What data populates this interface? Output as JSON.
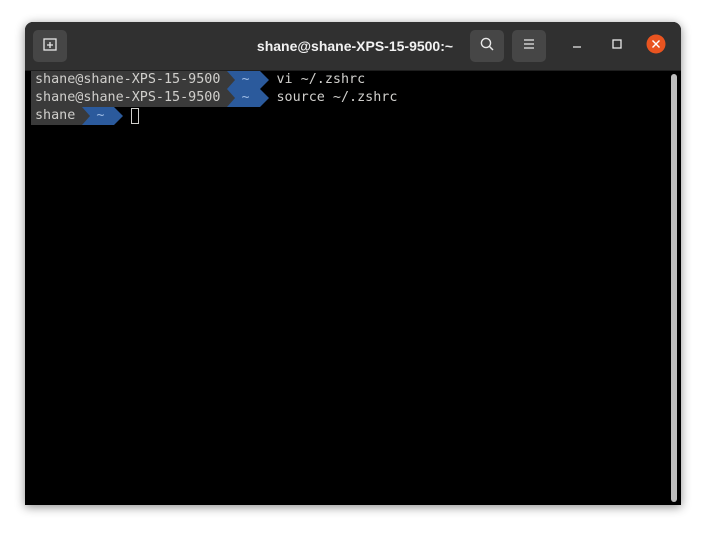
{
  "window": {
    "title": "shane@shane-XPS-15-9500:~"
  },
  "headerbar": {
    "new_tab_icon": "new-tab-icon",
    "search_icon": "search-icon",
    "menu_icon": "hamburger-menu-icon",
    "minimize_icon": "minimize-icon",
    "maximize_icon": "maximize-icon",
    "close_icon": "close-icon"
  },
  "terminal": {
    "lines": [
      {
        "user": "shane@shane-XPS-15-9500",
        "path": "~",
        "command": "vi ~/.zshrc"
      },
      {
        "user": "shane@shane-XPS-15-9500",
        "path": "~",
        "command": "source ~/.zshrc"
      },
      {
        "user": "shane",
        "path": "~",
        "command": ""
      }
    ]
  },
  "colors": {
    "prompt_user_bg": "#3a3a3a",
    "prompt_path_bg": "#2b5a9c",
    "close_button": "#e95420",
    "terminal_bg": "#000000",
    "headerbar_bg": "#303030"
  }
}
